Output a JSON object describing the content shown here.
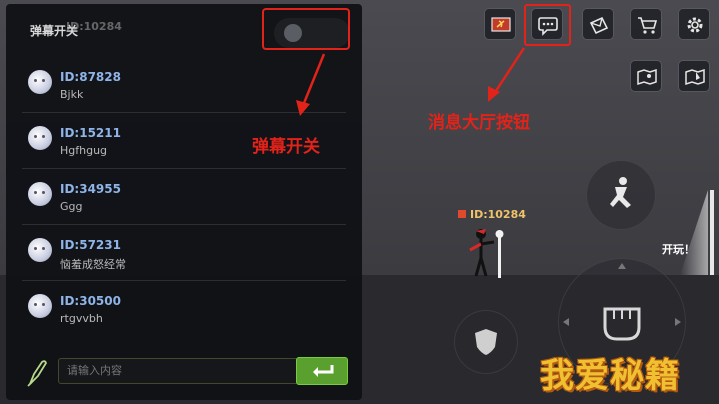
{
  "panel": {
    "header_label": "弹幕开关",
    "header_ghost": "ID:10284",
    "toggle_on": false,
    "messages": [
      {
        "id": "ID:87828",
        "name": "Bjkk"
      },
      {
        "id": "ID:15211",
        "name": "Hgfhgug"
      },
      {
        "id": "ID:34955",
        "name": "Ggg"
      },
      {
        "id": "ID:57231",
        "name": "恼羞成怒经常"
      },
      {
        "id": "ID:30500",
        "name": "rtgvvbh"
      }
    ],
    "input_placeholder": "请输入内容"
  },
  "annotations": {
    "toggle_label": "弹幕开关",
    "chat_label": "消息大厅按钮"
  },
  "toolbar": {
    "icons": [
      "flag-icon",
      "chat-bubble-icon",
      "mail-icon",
      "cart-icon",
      "gear-icon"
    ],
    "secondary_icons": [
      "map-icon",
      "map-pin-icon"
    ]
  },
  "game": {
    "player_tag": "ID:10284",
    "start_label": "开玩！"
  },
  "watermark": "我爱秘籍",
  "colors": {
    "annotation_red": "#e2231a",
    "send_green": "#5aa02e",
    "id_blue": "#8fb4e8",
    "player_gold": "#f0c36a"
  }
}
